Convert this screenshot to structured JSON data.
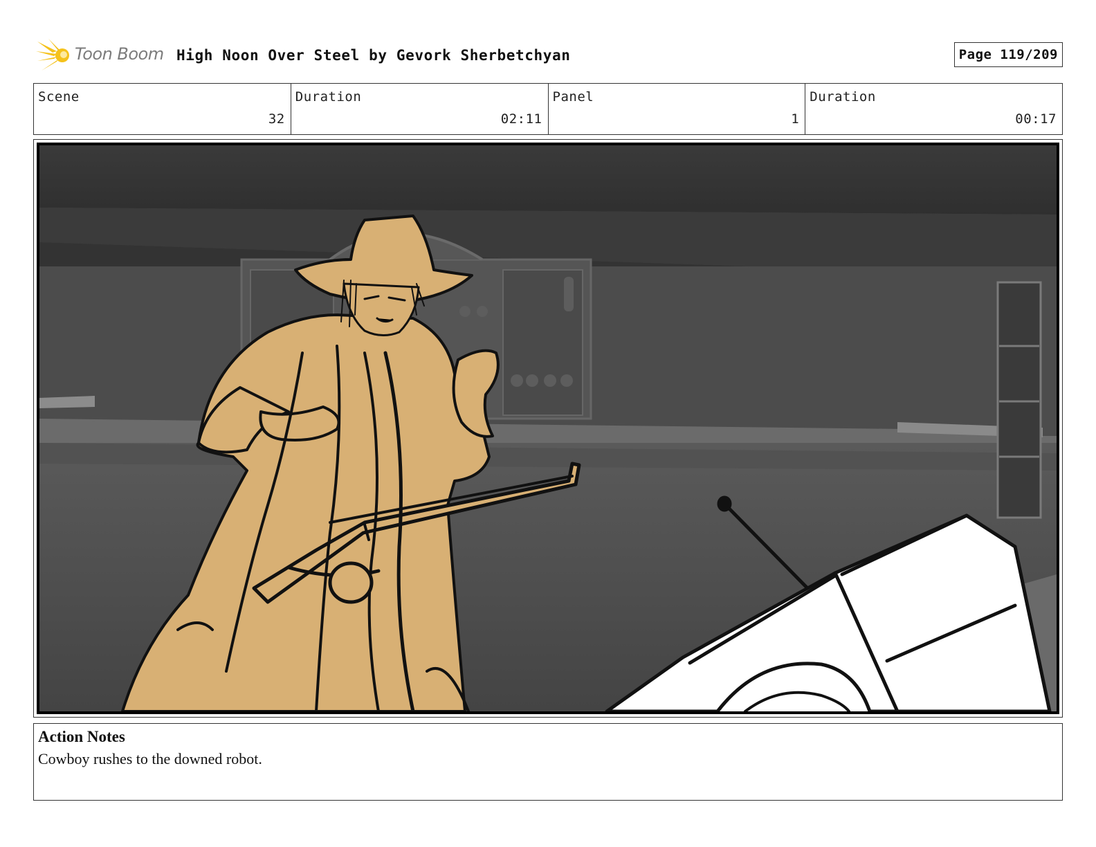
{
  "header": {
    "logo_text": "Toon Boom",
    "title": "High Noon Over Steel by Gevork Sherbetchyan",
    "page": "Page 119/209"
  },
  "info": [
    {
      "label": "Scene",
      "value": "32"
    },
    {
      "label": "Duration",
      "value": "02:11"
    },
    {
      "label": "Panel",
      "value": "1"
    },
    {
      "label": "Duration",
      "value": "00:17"
    }
  ],
  "panel": {
    "icons": [
      "cowboy-sketch",
      "downed-robot-sketch",
      "saloon-background"
    ]
  },
  "notes": {
    "title": "Action Notes",
    "body": "Cowboy rushes to the downed robot."
  },
  "colors": {
    "logo_yellow": "#f5c21b",
    "cowboy_fill": "#d8b074",
    "background_gray": "#4a4a4a"
  }
}
